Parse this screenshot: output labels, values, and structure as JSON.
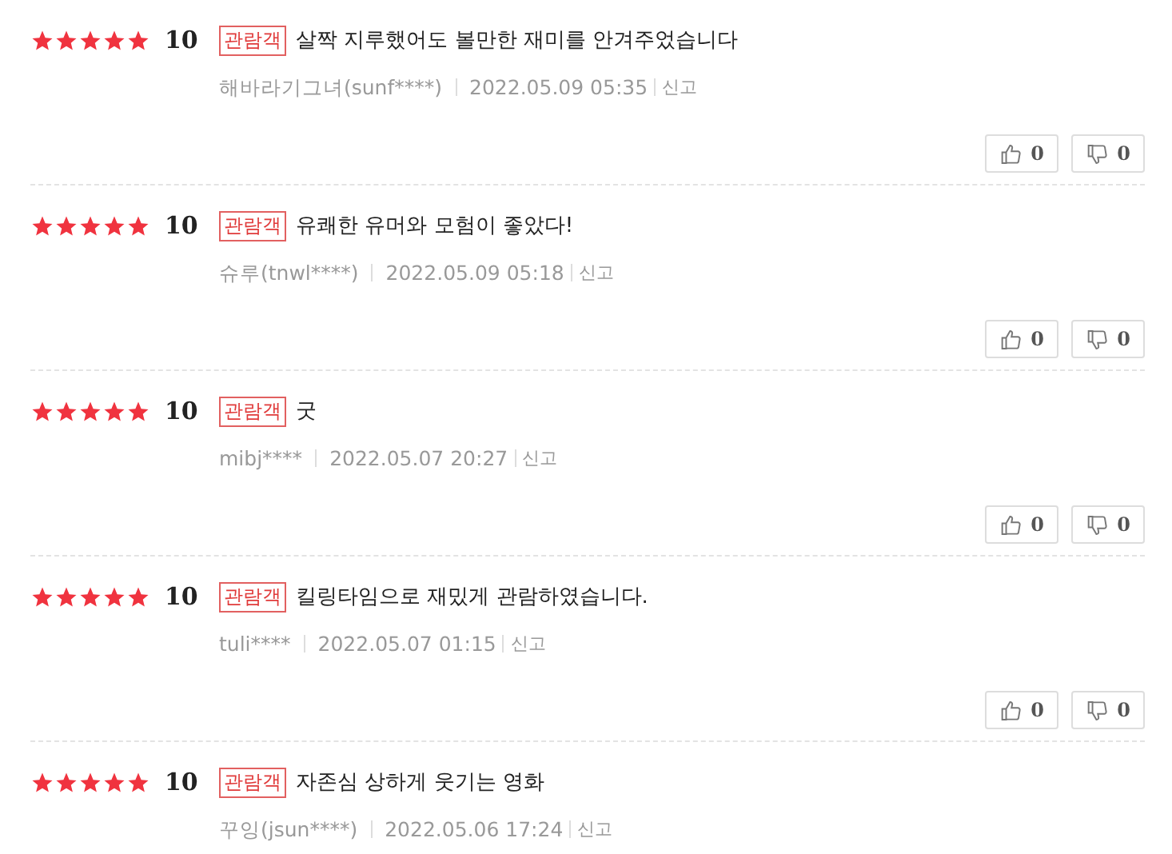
{
  "reviews": [
    {
      "stars": 5,
      "score": "10",
      "badge": "관람객",
      "text": "살짝 지루했어도 볼만한 재미를 안겨주었습니다",
      "author": "해바라기그녀(sunf****)",
      "date": "2022.05.09 05:35",
      "report": "신고",
      "likes": "0",
      "dislikes": "0"
    },
    {
      "stars": 5,
      "score": "10",
      "badge": "관람객",
      "text": "유쾌한 유머와 모험이 좋았다!",
      "author": "슈루(tnwl****)",
      "date": "2022.05.09 05:18",
      "report": "신고",
      "likes": "0",
      "dislikes": "0"
    },
    {
      "stars": 5,
      "score": "10",
      "badge": "관람객",
      "text": "굿",
      "author": "mibj****",
      "date": "2022.05.07 20:27",
      "report": "신고",
      "likes": "0",
      "dislikes": "0"
    },
    {
      "stars": 5,
      "score": "10",
      "badge": "관람객",
      "text": "킬링타임으로 재밌게 관람하였습니다.",
      "author": "tuli****",
      "date": "2022.05.07 01:15",
      "report": "신고",
      "likes": "0",
      "dislikes": "0"
    },
    {
      "stars": 5,
      "score": "10",
      "badge": "관람객",
      "text": "자존심 상하게 웃기는 영화",
      "author": "꾸잉(jsun****)",
      "date": "2022.05.06 17:24",
      "report": "신고"
    }
  ]
}
